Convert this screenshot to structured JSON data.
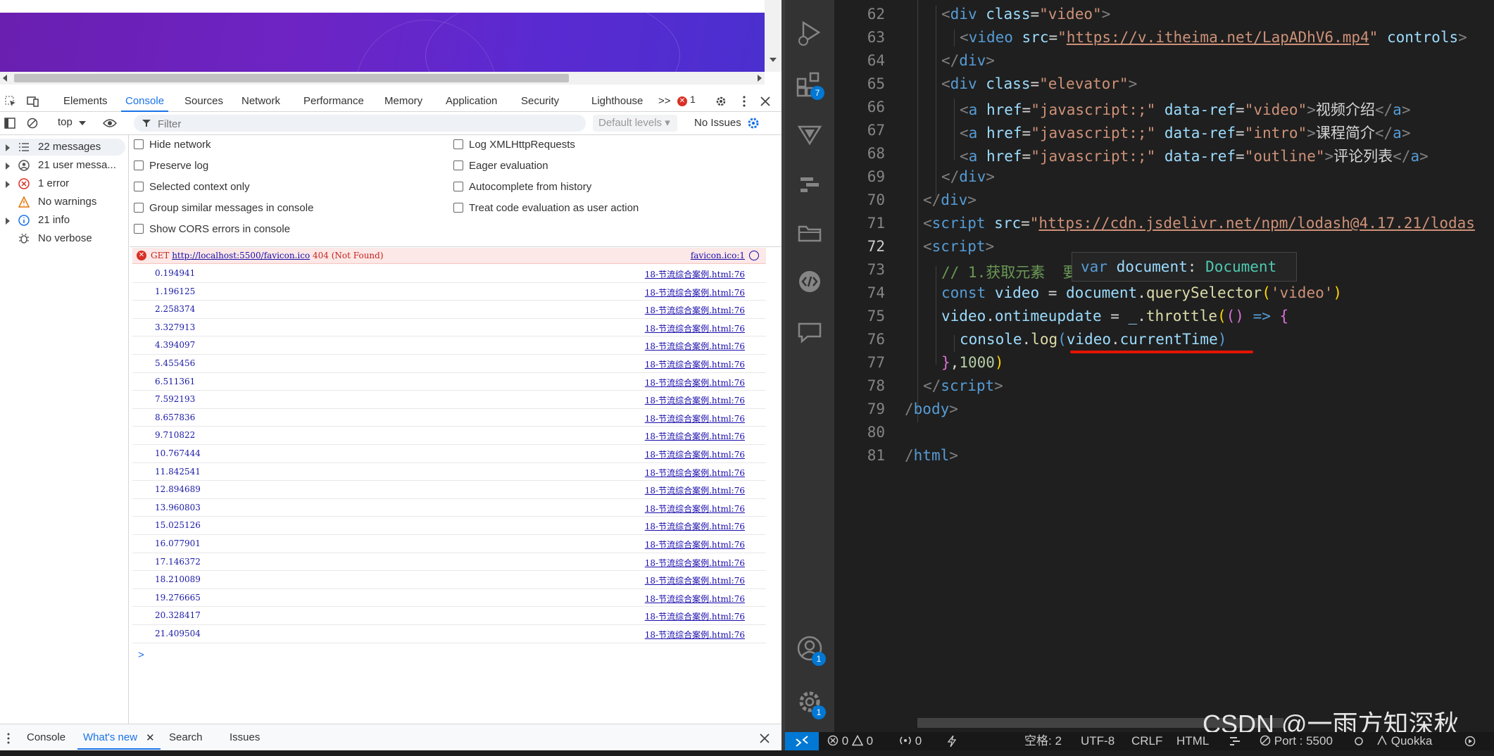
{
  "devtools": {
    "tabs": [
      "Elements",
      "Console",
      "Sources",
      "Network",
      "Performance",
      "Memory",
      "Application",
      "Security",
      "Lighthouse"
    ],
    "active_tab": "Console",
    "more_label": ">>",
    "error_count": "1",
    "toolbar": {
      "context": "top",
      "filter_placeholder": "Filter",
      "levels": "Default levels",
      "issues": "No Issues"
    },
    "sidebar": [
      {
        "label": "22 messages",
        "icon": "list-icon"
      },
      {
        "label": "21 user messa...",
        "icon": "user-icon"
      },
      {
        "label": "1 error",
        "icon": "error-icon"
      },
      {
        "label": "No warnings",
        "icon": "warning-icon"
      },
      {
        "label": "21 info",
        "icon": "info-icon"
      },
      {
        "label": "No verbose",
        "icon": "bug-icon"
      }
    ],
    "settings_left": [
      "Hide network",
      "Preserve log",
      "Selected context only",
      "Group similar messages in console",
      "Show CORS errors in console"
    ],
    "settings_right": [
      "Log XMLHttpRequests",
      "Eager evaluation",
      "Autocomplete from history",
      "Treat code evaluation as user action"
    ],
    "error_row": {
      "method": "GET",
      "url": "http://localhost:5500/favicon.ico",
      "status": "404 (Not Found)",
      "source": "favicon.ico:1"
    },
    "logs": [
      "0.194941",
      "1.196125",
      "2.258374",
      "3.327913",
      "4.394097",
      "5.455456",
      "6.511361",
      "7.592193",
      "8.657836",
      "9.710822",
      "10.767444",
      "11.842541",
      "12.894689",
      "13.960803",
      "15.025126",
      "16.077901",
      "17.146372",
      "18.210089",
      "19.276665",
      "20.328417",
      "21.409504"
    ],
    "log_source": "18-节流综合案例.html:76",
    "prompt": ">",
    "drawer": [
      "Console",
      "What's new",
      "Search",
      "Issues"
    ],
    "drawer_active": "What's new"
  },
  "vscode": {
    "line_numbers": [
      "62",
      "63",
      "64",
      "65",
      "66",
      "67",
      "68",
      "69",
      "70",
      "71",
      "72",
      "73",
      "74",
      "75",
      "76",
      "77",
      "78",
      "79",
      "80",
      "81"
    ],
    "current_line": "72",
    "hover": {
      "keyword": "var",
      "name": "document",
      "sep": ":",
      "type": "Document"
    },
    "badges": {
      "extensions": "7",
      "accounts": "1",
      "settings": "1"
    },
    "status": {
      "errors": "0",
      "warnings": "0",
      "ports_count": "0",
      "spaces": "空格: 2",
      "encoding": "UTF-8",
      "eol": "CRLF",
      "language": "HTML",
      "port": "Port : 5500",
      "quokka": "Quokka"
    },
    "watermark": "CSDN @一雨方知深秋"
  },
  "code": {
    "l62": [
      "<",
      "div",
      " ",
      "class",
      "=",
      "\"video\"",
      ">"
    ],
    "l63": [
      "<",
      "video",
      " ",
      "src",
      "=",
      "\"",
      "https://v.itheima.net/LapADhV6.mp4",
      "\"",
      " ",
      "controls",
      ">"
    ],
    "l64": [
      "</",
      "div",
      ">"
    ],
    "l65": [
      "<",
      "div",
      " ",
      "class",
      "=",
      "\"elevator\"",
      ">"
    ],
    "l66": [
      "<",
      "a",
      " ",
      "href",
      "=",
      "\"javascript:;\"",
      " ",
      "data-ref",
      "=",
      "\"video\"",
      ">",
      "视频介绍",
      "</",
      "a",
      ">"
    ],
    "l67": [
      "<",
      "a",
      " ",
      "href",
      "=",
      "\"javascript:;\"",
      " ",
      "data-ref",
      "=",
      "\"intro\"",
      ">",
      "课程简介",
      "</",
      "a",
      ">"
    ],
    "l68": [
      "<",
      "a",
      " ",
      "href",
      "=",
      "\"javascript:;\"",
      " ",
      "data-ref",
      "=",
      "\"outline\"",
      ">",
      "评论列表",
      "</",
      "a",
      ">"
    ],
    "l69": [
      "</",
      "div",
      ">"
    ],
    "l70": [
      "</",
      "div",
      ">"
    ],
    "l71": [
      "<",
      "script",
      " ",
      "src",
      "=",
      "\"",
      "https://cdn.jsdelivr.net/npm/lodash@4.17.21/lodas"
    ],
    "l72": [
      "<",
      "script",
      ">"
    ],
    "l73": "// 1.获取元素  要",
    "l74": [
      "const",
      " ",
      "video",
      " = ",
      "document",
      ".",
      "querySelector",
      "(",
      "'video'",
      ")"
    ],
    "l75": [
      "video",
      ".",
      "ontimeupdate",
      " = ",
      "_",
      ".",
      "throttle",
      "(",
      "()",
      " => ",
      "{"
    ],
    "l76": [
      "console",
      ".",
      "log",
      "(",
      "video",
      ".",
      "currentTime",
      ")"
    ],
    "l77": [
      "}",
      ",",
      "1000",
      ")"
    ],
    "l78": [
      "</",
      "script",
      ">"
    ],
    "l79": [
      "/",
      "body",
      ">"
    ],
    "l81": [
      "/",
      "html",
      ">"
    ]
  }
}
